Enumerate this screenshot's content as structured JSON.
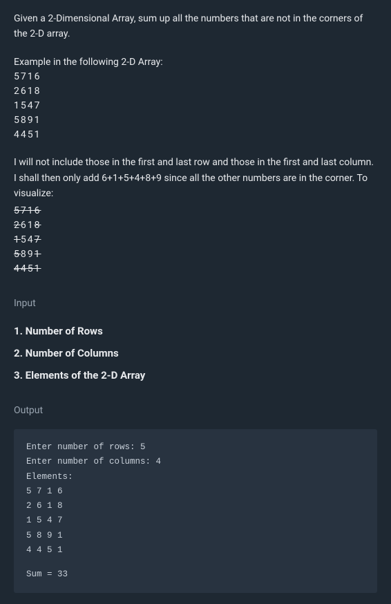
{
  "intro": "Given a 2-Dimensional Array, sum up all the numbers that are not in the corners of the 2-D array.",
  "example_label": "Example in the following 2-D Array:",
  "array_rows": [
    "5716",
    "2618",
    "1547",
    "5891",
    "4451"
  ],
  "explanation": "I will not include those in the first and last row and those in the first and last column. I shall then only add 6+1+5+4+8+9 since all the other numbers are in the corner. To visualize:",
  "strike_rows": {
    "row0": "5716",
    "row1_s0": "2",
    "row1_m": "61",
    "row1_s1": "8",
    "row2_s0": "1",
    "row2_m": "54",
    "row2_s1": "7",
    "row3_s0": "5",
    "row3_m": "89",
    "row3_s1": "1",
    "row4": "4451"
  },
  "input_label": "Input",
  "inputs": {
    "i1": "1. Number of Rows",
    "i2": "2. Number of Columns",
    "i3": "3. Elements of the 2-D Array"
  },
  "output_label": "Output",
  "code": {
    "l1": "Enter number of rows: 5",
    "l2": "Enter number of columns: 4",
    "l3": "Elements:",
    "l4": "5 7 1 6",
    "l5": "2 6 1 8",
    "l6": "1 5 4 7",
    "l7": "5 8 9 1",
    "l8": "4 4 5 1",
    "l9": "Sum = 33"
  }
}
